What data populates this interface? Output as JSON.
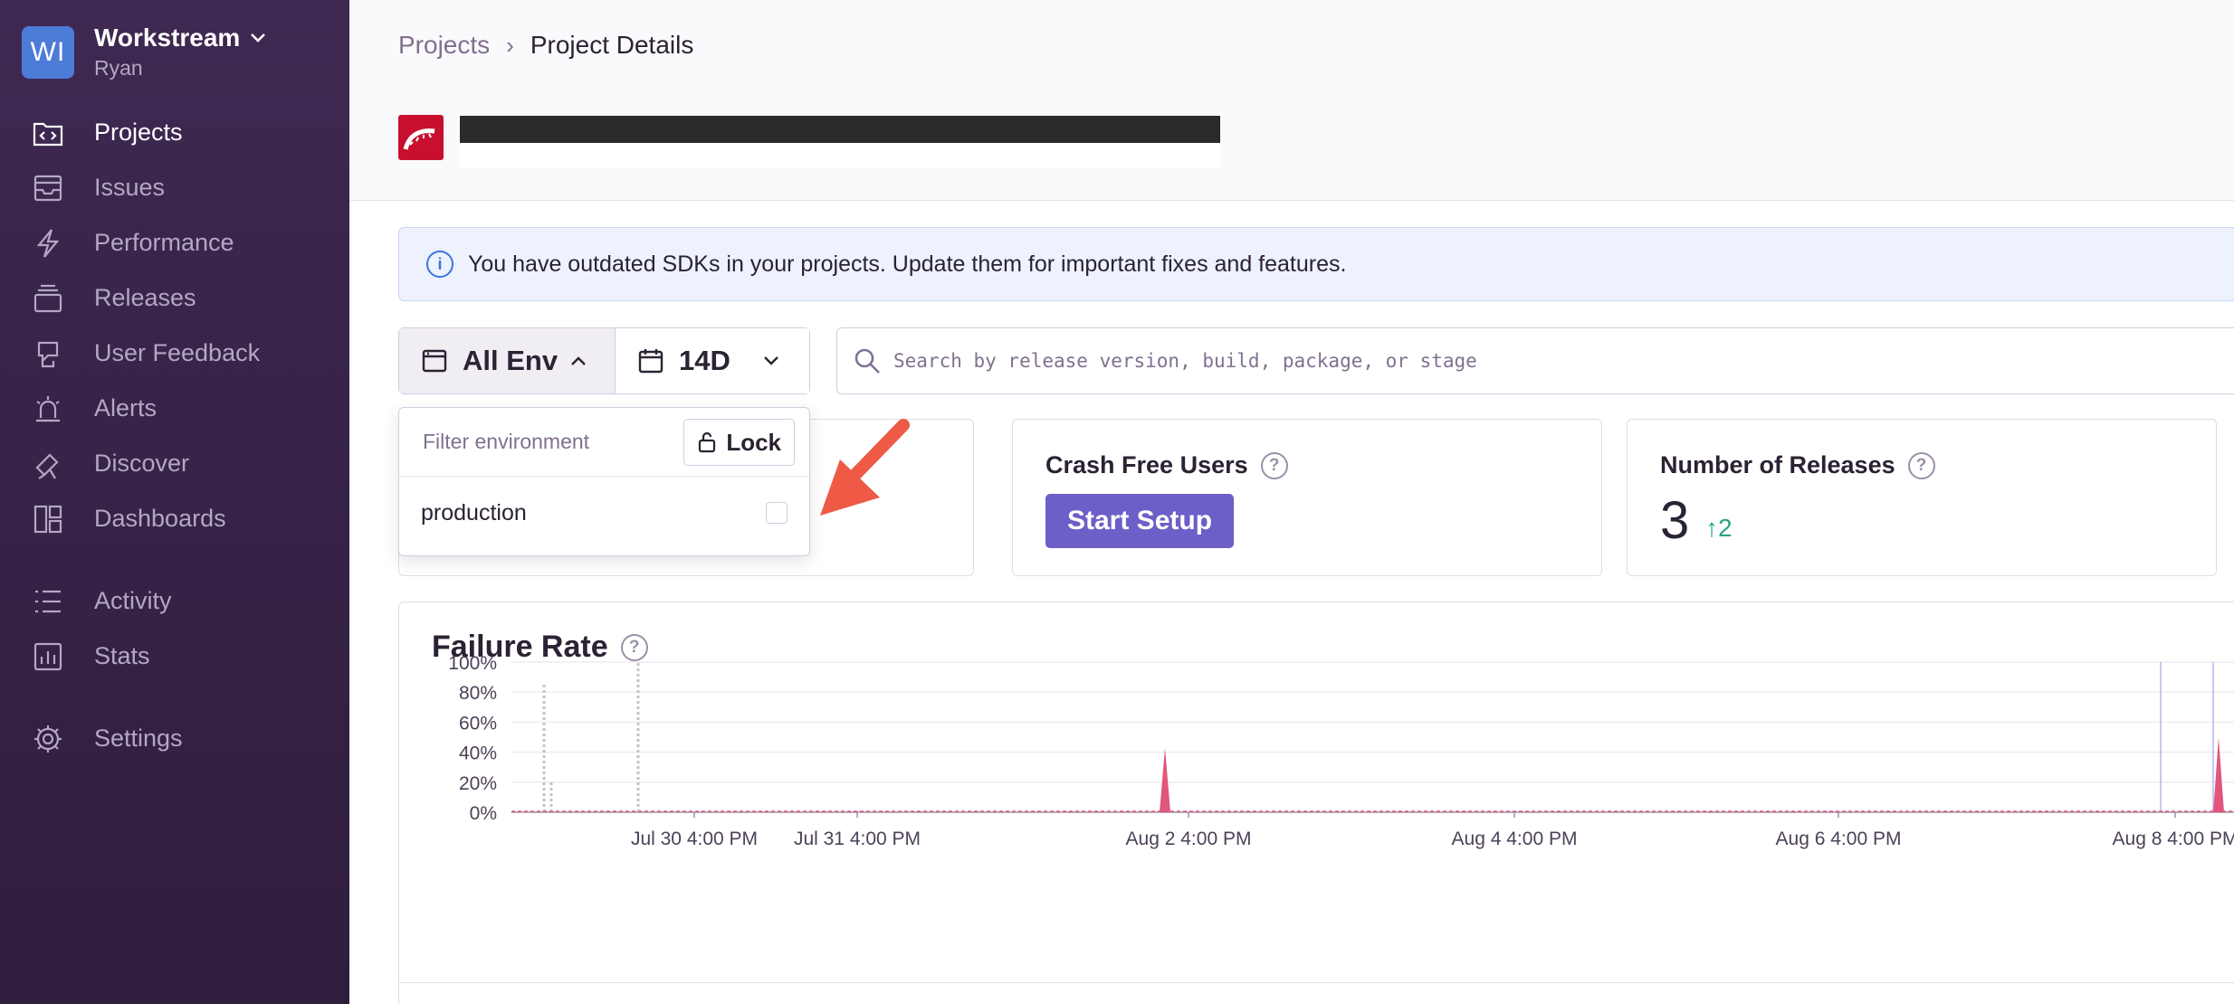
{
  "org": {
    "initials": "WI",
    "name": "Workstream",
    "user": "Ryan"
  },
  "nav": [
    {
      "label": "Projects",
      "icon": "projects-icon",
      "active": true
    },
    {
      "label": "Issues",
      "icon": "issues-icon"
    },
    {
      "label": "Performance",
      "icon": "performance-icon"
    },
    {
      "label": "Releases",
      "icon": "releases-icon"
    },
    {
      "label": "User Feedback",
      "icon": "user-feedback-icon"
    },
    {
      "label": "Alerts",
      "icon": "alerts-icon"
    },
    {
      "label": "Discover",
      "icon": "discover-icon"
    },
    {
      "label": "Dashboards",
      "icon": "dashboards-icon"
    },
    {
      "label": "Activity",
      "icon": "activity-icon"
    },
    {
      "label": "Stats",
      "icon": "stats-icon"
    },
    {
      "label": "Settings",
      "icon": "settings-icon"
    }
  ],
  "breadcrumb": {
    "parent": "Projects",
    "current": "Project Details"
  },
  "alert": {
    "text": "You have outdated SDKs in your projects. Update them for important fixes and features."
  },
  "filters": {
    "env_label": "All Env",
    "period_label": "14D",
    "search_placeholder": "Search by release version, build, package, or stage"
  },
  "env_dropdown": {
    "placeholder": "Filter environment",
    "lock_label": "Lock",
    "options": [
      "production"
    ]
  },
  "cards": {
    "crash_free_users": {
      "title": "Crash Free Users",
      "button": "Start Setup"
    },
    "releases": {
      "title": "Number of Releases",
      "value": "3",
      "delta": "↑2"
    }
  },
  "chart_data": {
    "type": "area",
    "title": "Failure Rate",
    "y_ticks": [
      "100%",
      "80%",
      "60%",
      "40%",
      "20%",
      "0%"
    ],
    "ylim": [
      0,
      100
    ],
    "x_ticks": [
      "Jul 30 4:00 PM",
      "Jul 31 4:00 PM",
      "Aug 2 4:00 PM",
      "Aug 4 4:00 PM",
      "Aug 6 4:00 PM",
      "Aug 8 4:00 PM"
    ],
    "series": [
      {
        "color": "#e1567c",
        "points": [
          {
            "x": "Aug 2 4:00 PM",
            "y": 43
          },
          {
            "x": "Aug 8 4:00 PM",
            "y": 50
          }
        ]
      }
    ],
    "previous_period_spikes": [
      {
        "x": "Jul 29",
        "y": 85
      },
      {
        "x": "Jul 29",
        "y": 20
      },
      {
        "x": "Jul 30",
        "y": 100
      }
    ],
    "grid": true,
    "colors": {
      "failure": "#e1567c",
      "previous": "#c6c0cc",
      "release_marker": "#b9b3f2"
    }
  },
  "colors": {
    "sidebar": "#3e2952",
    "accent": "#6c5fc7",
    "positive": "#2ba185",
    "info": "#3d74db"
  }
}
